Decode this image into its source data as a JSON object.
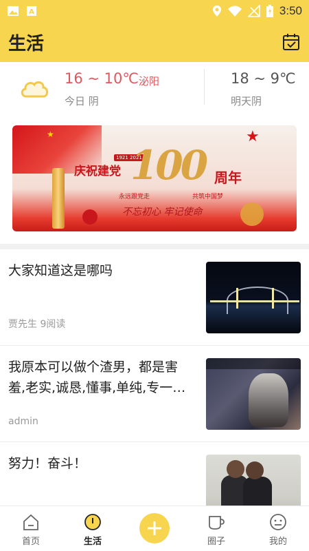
{
  "status_bar": {
    "time": "3:50",
    "icons": [
      "image-icon",
      "a-badge-icon",
      "location-icon",
      "wifi-icon",
      "signal-off-icon",
      "battery-charging-icon"
    ]
  },
  "app_bar": {
    "title": "生活",
    "action_icon": "calendar-check-icon"
  },
  "weather": {
    "icon": "cloud-icon",
    "today": {
      "temp": "16 ~ 10℃",
      "city": "泌阳",
      "desc": "今日 阴"
    },
    "tomorrow": {
      "temp": "18 ~ 9℃",
      "desc": "明天阴"
    }
  },
  "banner": {
    "dates": "1921 2021",
    "heading": "庆祝建党",
    "number": "100",
    "suffix": "周年",
    "sub_left": "永远跟党走",
    "sub_right": "共筑中国梦",
    "slogan": "不忘初心  牢记使命"
  },
  "articles": [
    {
      "title": "大家知道这是哪吗",
      "meta": "贾先生 9阅读",
      "thumb": "night-bridge"
    },
    {
      "title": "我原本可以做个渣男，都是害羞,老实,诚恳,懂事,单纯,专一…",
      "meta": "admin",
      "thumb": "game-screenshot"
    },
    {
      "title": "努力！奋斗！",
      "meta": "",
      "thumb": "meeting-photo"
    }
  ],
  "bottom_nav": [
    {
      "label": "首页",
      "icon": "home-icon",
      "active": false
    },
    {
      "label": "生活",
      "icon": "life-icon",
      "active": true
    },
    {
      "label": "",
      "icon": "plus-icon",
      "active": false
    },
    {
      "label": "圈子",
      "icon": "cup-icon",
      "active": false
    },
    {
      "label": "我的",
      "icon": "smiley-icon",
      "active": false
    }
  ],
  "colors": {
    "primary": "#f7d54e",
    "accent_red": "#e0575d",
    "text_gray": "#999999"
  }
}
